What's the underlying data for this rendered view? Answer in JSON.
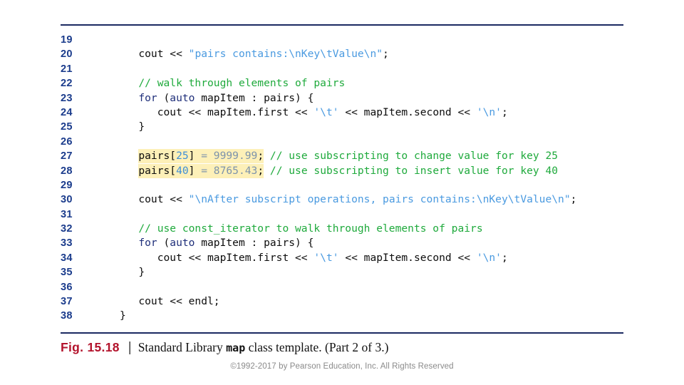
{
  "figure": {
    "number_label": "Fig. 15.18",
    "separator": "|",
    "caption_before": "Standard Library ",
    "caption_mono": "map",
    "caption_after": " class template. (Part 2 of 3.)",
    "accent_color": "#b3132c"
  },
  "copyright": "©1992-2017 by Pearson Education, Inc. All Rights Reserved",
  "colors": {
    "rule": "#1b2a62",
    "line_number": "#1b3c8c",
    "keyword": "#1f2f7a",
    "string": "#4a9ae0",
    "comment": "#1faa3c",
    "number": "#3f8fd6",
    "value": "#7d93ab",
    "highlight": "#fdf0b8",
    "plain": "#0d0d0d"
  },
  "code": {
    "language": "cpp",
    "first_line_number": 19,
    "last_line_number": 38,
    "lines": [
      {
        "n": "19",
        "text": ""
      },
      {
        "n": "20",
        "text": "   cout << \"pairs contains:\\nKey\\tValue\\n\";"
      },
      {
        "n": "21",
        "text": ""
      },
      {
        "n": "22",
        "text": "   // walk through elements of pairs"
      },
      {
        "n": "23",
        "text": "   for (auto mapItem : pairs) {"
      },
      {
        "n": "24",
        "text": "      cout << mapItem.first << '\\t' << mapItem.second << '\\n';"
      },
      {
        "n": "25",
        "text": "   }"
      },
      {
        "n": "26",
        "text": ""
      },
      {
        "n": "27",
        "text": "   pairs[25] = 9999.99; // use subscripting to change value for key 25"
      },
      {
        "n": "28",
        "text": "   pairs[40] = 8765.43; // use subscripting to insert value for key 40"
      },
      {
        "n": "29",
        "text": ""
      },
      {
        "n": "30",
        "text": "   cout << \"\\nAfter subscript operations, pairs contains:\\nKey\\tValue\\n\";"
      },
      {
        "n": "31",
        "text": ""
      },
      {
        "n": "32",
        "text": "   // use const_iterator to walk through elements of pairs"
      },
      {
        "n": "33",
        "text": "   for (auto mapItem : pairs) {"
      },
      {
        "n": "34",
        "text": "      cout << mapItem.first << '\\t' << mapItem.second << '\\n';"
      },
      {
        "n": "35",
        "text": "   }"
      },
      {
        "n": "36",
        "text": ""
      },
      {
        "n": "37",
        "text": "   cout << endl;"
      },
      {
        "n": "38",
        "text": "}"
      }
    ],
    "tokens": {
      "ln19": [],
      "ln20": [
        {
          "t": "   cout << ",
          "c": "plain"
        },
        {
          "t": "\"pairs contains:\\nKey\\tValue\\n\"",
          "c": "str"
        },
        {
          "t": ";",
          "c": "plain"
        }
      ],
      "ln21": [],
      "ln22": [
        {
          "t": "   ",
          "c": "plain"
        },
        {
          "t": "// walk through elements of pairs",
          "c": "cmt"
        }
      ],
      "ln23": [
        {
          "t": "   ",
          "c": "plain"
        },
        {
          "t": "for",
          "c": "kw"
        },
        {
          "t": " (",
          "c": "plain"
        },
        {
          "t": "auto",
          "c": "kw"
        },
        {
          "t": " mapItem : pairs) {",
          "c": "plain"
        }
      ],
      "ln24": [
        {
          "t": "      cout << mapItem.first << ",
          "c": "plain"
        },
        {
          "t": "'\\t'",
          "c": "str"
        },
        {
          "t": " << mapItem.second << ",
          "c": "plain"
        },
        {
          "t": "'\\n'",
          "c": "str"
        },
        {
          "t": ";",
          "c": "plain"
        }
      ],
      "ln25": [
        {
          "t": "   }",
          "c": "plain"
        }
      ],
      "ln26": [],
      "ln27": [
        {
          "t": "   ",
          "c": "plain"
        },
        {
          "t": "pairs[",
          "c": "plain",
          "hl": true
        },
        {
          "t": "25",
          "c": "num",
          "hl": true
        },
        {
          "t": "] ",
          "c": "plain",
          "hl": true
        },
        {
          "t": "= 9999.99",
          "c": "val",
          "hl": true
        },
        {
          "t": ";",
          "c": "plain",
          "hl": true
        },
        {
          "t": " ",
          "c": "plain"
        },
        {
          "t": "// use subscripting to change value for key 25",
          "c": "cmt"
        }
      ],
      "ln28": [
        {
          "t": "   ",
          "c": "plain"
        },
        {
          "t": "pairs[",
          "c": "plain",
          "hl": true
        },
        {
          "t": "40",
          "c": "num",
          "hl": true
        },
        {
          "t": "] ",
          "c": "plain",
          "hl": true
        },
        {
          "t": "= 8765.43",
          "c": "val",
          "hl": true
        },
        {
          "t": ";",
          "c": "plain",
          "hl": true
        },
        {
          "t": " ",
          "c": "plain"
        },
        {
          "t": "// use subscripting to insert value for key 40",
          "c": "cmt"
        }
      ],
      "ln29": [],
      "ln30": [
        {
          "t": "   cout << ",
          "c": "plain"
        },
        {
          "t": "\"\\nAfter subscript operations, pairs contains:\\nKey\\tValue\\n\"",
          "c": "str"
        },
        {
          "t": ";",
          "c": "plain"
        }
      ],
      "ln31": [],
      "ln32": [
        {
          "t": "   ",
          "c": "plain"
        },
        {
          "t": "// use const_iterator to walk through elements of pairs",
          "c": "cmt"
        }
      ],
      "ln33": [
        {
          "t": "   ",
          "c": "plain"
        },
        {
          "t": "for",
          "c": "kw"
        },
        {
          "t": " (",
          "c": "plain"
        },
        {
          "t": "auto",
          "c": "kw"
        },
        {
          "t": " mapItem : pairs) {",
          "c": "plain"
        }
      ],
      "ln34": [
        {
          "t": "      cout << mapItem.first << ",
          "c": "plain"
        },
        {
          "t": "'\\t'",
          "c": "str"
        },
        {
          "t": " << mapItem.second << ",
          "c": "plain"
        },
        {
          "t": "'\\n'",
          "c": "str"
        },
        {
          "t": ";",
          "c": "plain"
        }
      ],
      "ln35": [
        {
          "t": "   }",
          "c": "plain"
        }
      ],
      "ln36": [],
      "ln37": [
        {
          "t": "   cout << endl;",
          "c": "plain"
        }
      ],
      "ln38": [
        {
          "t": "}",
          "c": "plain"
        }
      ]
    }
  }
}
